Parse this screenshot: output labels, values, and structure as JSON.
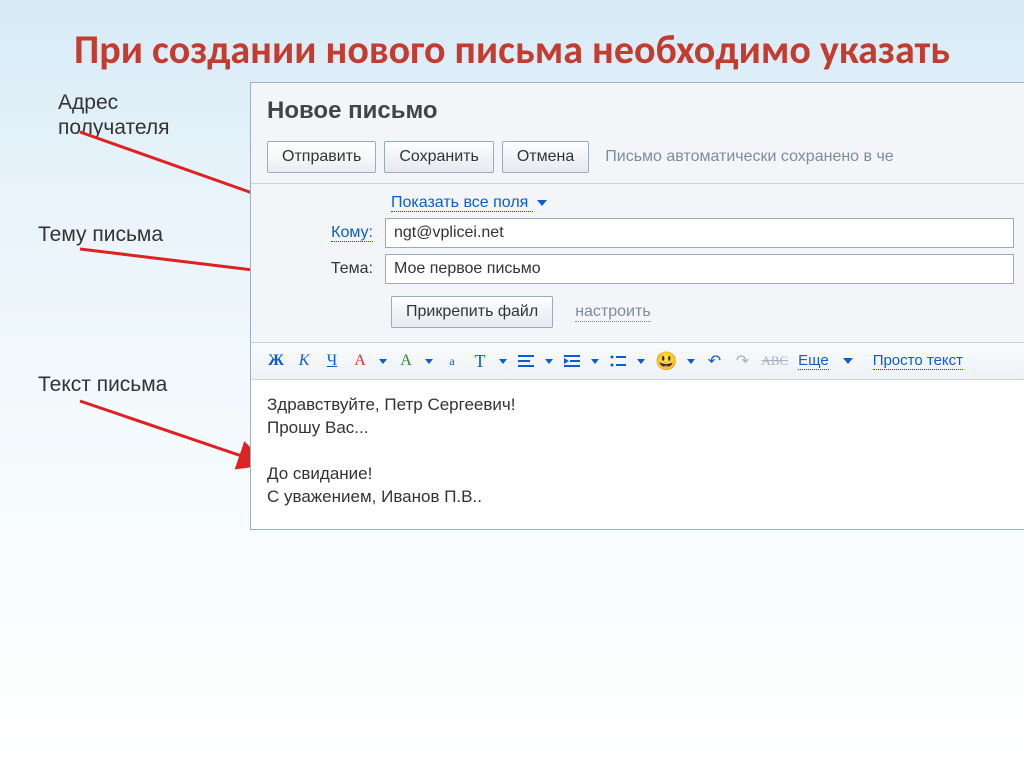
{
  "slide": {
    "title": "При создании нового письма необходимо указать"
  },
  "callouts": {
    "address": "Адрес получателя",
    "subject": "Тему письма",
    "body": "Текст письма"
  },
  "window": {
    "title": "Новое письмо",
    "buttons": {
      "send": "Отправить",
      "save": "Сохранить",
      "cancel": "Отмена"
    },
    "status": "Письмо автоматически сохранено в че",
    "show_all_fields": "Показать все поля",
    "to_label": "Кому:",
    "to_value": "ngt@vplicei.net",
    "subject_label": "Тема:",
    "subject_value": "Мое первое письмо",
    "attach_button": "Прикрепить файл",
    "configure_link": "настроить",
    "format": {
      "bold": "Ж",
      "italic": "К",
      "underline": "Ч",
      "color": "А",
      "highlight": "А",
      "small_a": "а",
      "big_t": "Т",
      "more": "Еще",
      "plain": "Просто текст",
      "strike": "ABC",
      "undo": "↶",
      "redo": "↷"
    },
    "body_text": "Здравствуйте, Петр Сергеевич!\nПрошу Вас...\n\nДо свидание!\nС уважением, Иванов П.В.."
  }
}
